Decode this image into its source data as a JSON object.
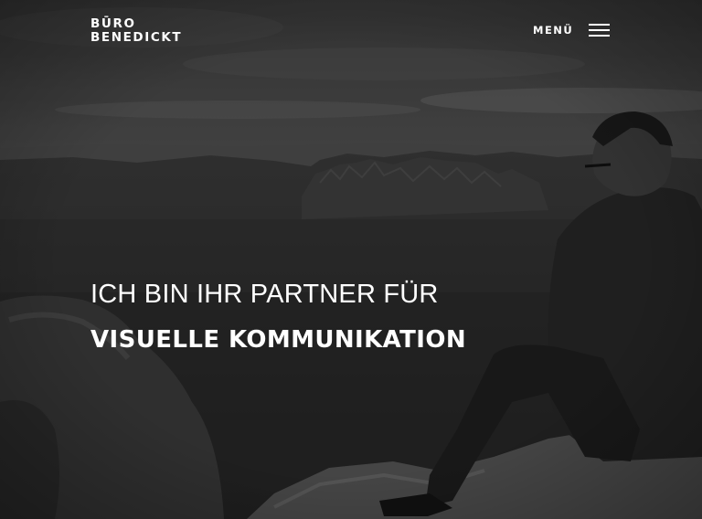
{
  "header": {
    "logo_line1": "BŪRO",
    "logo_line2": "BENEDICKT",
    "menu_label": "MENÜ",
    "menu_icon": "hamburger-icon"
  },
  "hero": {
    "headline_line1": "ICH BIN IHR PARTNER FÜR",
    "headline_line2": "VISUELLE KOMMUNIKATION"
  },
  "colors": {
    "text": "#ffffff",
    "overlay": "#000000"
  }
}
